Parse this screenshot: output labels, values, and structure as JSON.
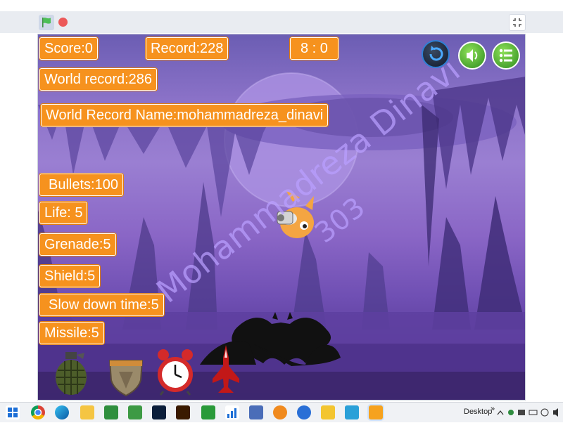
{
  "hud": {
    "score": "Score:0",
    "record": "Record:228",
    "timer": "8 : 0",
    "world_record": "World record:286",
    "world_record_name": "World Record Name:mohammadreza_dinavi",
    "bullets": "Bullets:100",
    "life": "Life: 5",
    "grenade": "Grenade:5",
    "shield": "Shield:5",
    "slow_down": "Slow down time:5",
    "missile": "Missile:5"
  },
  "watermark": {
    "name": "Mohammadreza Dinavi",
    "number": "303"
  },
  "taskbar": {
    "desktop_label": "Desktop",
    "chevron": "»"
  },
  "icons": {
    "flag": "green-flag-icon",
    "stop": "stop-icon",
    "fullscreen": "fullscreen-icon",
    "restart": "restart-icon",
    "sound": "sound-icon",
    "menu": "menu-icon",
    "grenade": "grenade-icon",
    "shield": "shield-icon",
    "clock": "alarm-clock-icon",
    "missile": "jet-icon"
  },
  "colors": {
    "label_bg": "#f6921e",
    "stage_sky": "#8b72c8",
    "flag": "#4cbf56",
    "stop": "#ec5959"
  }
}
